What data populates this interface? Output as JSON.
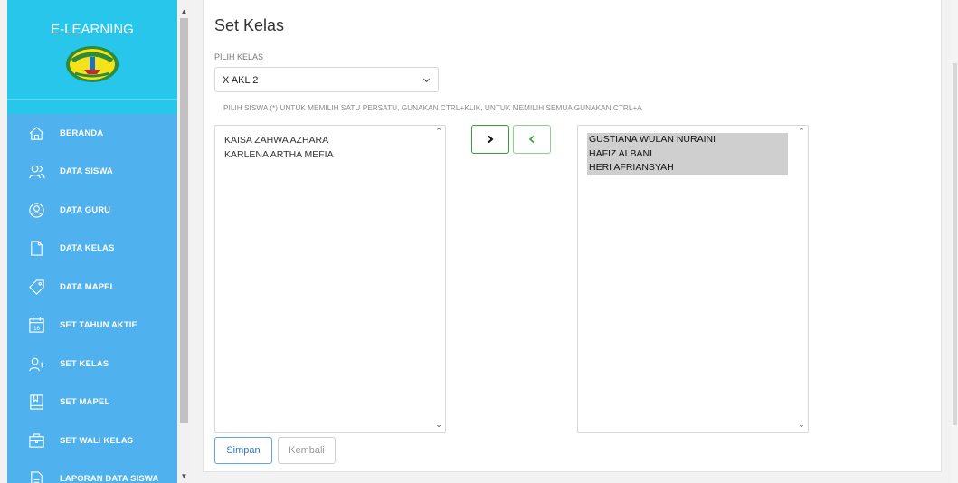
{
  "sidebar": {
    "brand": "E-LEARNING",
    "logo_text": "SMK NEGERI 1",
    "items": [
      {
        "label": "BERANDA",
        "icon": "home-icon"
      },
      {
        "label": "DATA SISWA",
        "icon": "users-icon"
      },
      {
        "label": "DATA GURU",
        "icon": "user-circle-icon"
      },
      {
        "label": "DATA KELAS",
        "icon": "file-icon"
      },
      {
        "label": "DATA MAPEL",
        "icon": "tag-icon"
      },
      {
        "label": "SET TAHUN AKTIF",
        "icon": "calendar-icon",
        "icon_text": "16"
      },
      {
        "label": "SET KELAS",
        "icon": "user-plus-icon"
      },
      {
        "label": "SET MAPEL",
        "icon": "book-icon"
      },
      {
        "label": "SET WALI KELAS",
        "icon": "briefcase-icon"
      },
      {
        "label": "LAPORAN DATA SISWA",
        "icon": "report-icon"
      }
    ]
  },
  "main": {
    "title": "Set Kelas",
    "class_label": "PILIH KELAS",
    "class_value": "X AKL 2",
    "hint": "PILIH SISWA (*) UNTUK MEMILIH SATU PERSATU, GUNAKAN CTRL+KLIK, UNTUK MEMILIH SEMUA GUNAKAN CTRL+A",
    "available_students": [
      "KAISA ZAHWA AZHARA",
      "KARLENA ARTHA MEFIA"
    ],
    "selected_students": [
      "GUSTIANA WULAN NURAINI",
      "HAFIZ ALBANI",
      "HERI AFRIANSYAH"
    ],
    "move_right_icon": "chevron-right-icon",
    "move_left_icon": "chevron-left-icon",
    "save_label": "Simpan",
    "back_label": "Kembali"
  },
  "colors": {
    "brand_bg": "#29c6ec",
    "nav_bg": "#4fb1ee",
    "selection_bg": "#cfcfcf",
    "primary": "#2c74cc",
    "success": "#2ea52e"
  }
}
